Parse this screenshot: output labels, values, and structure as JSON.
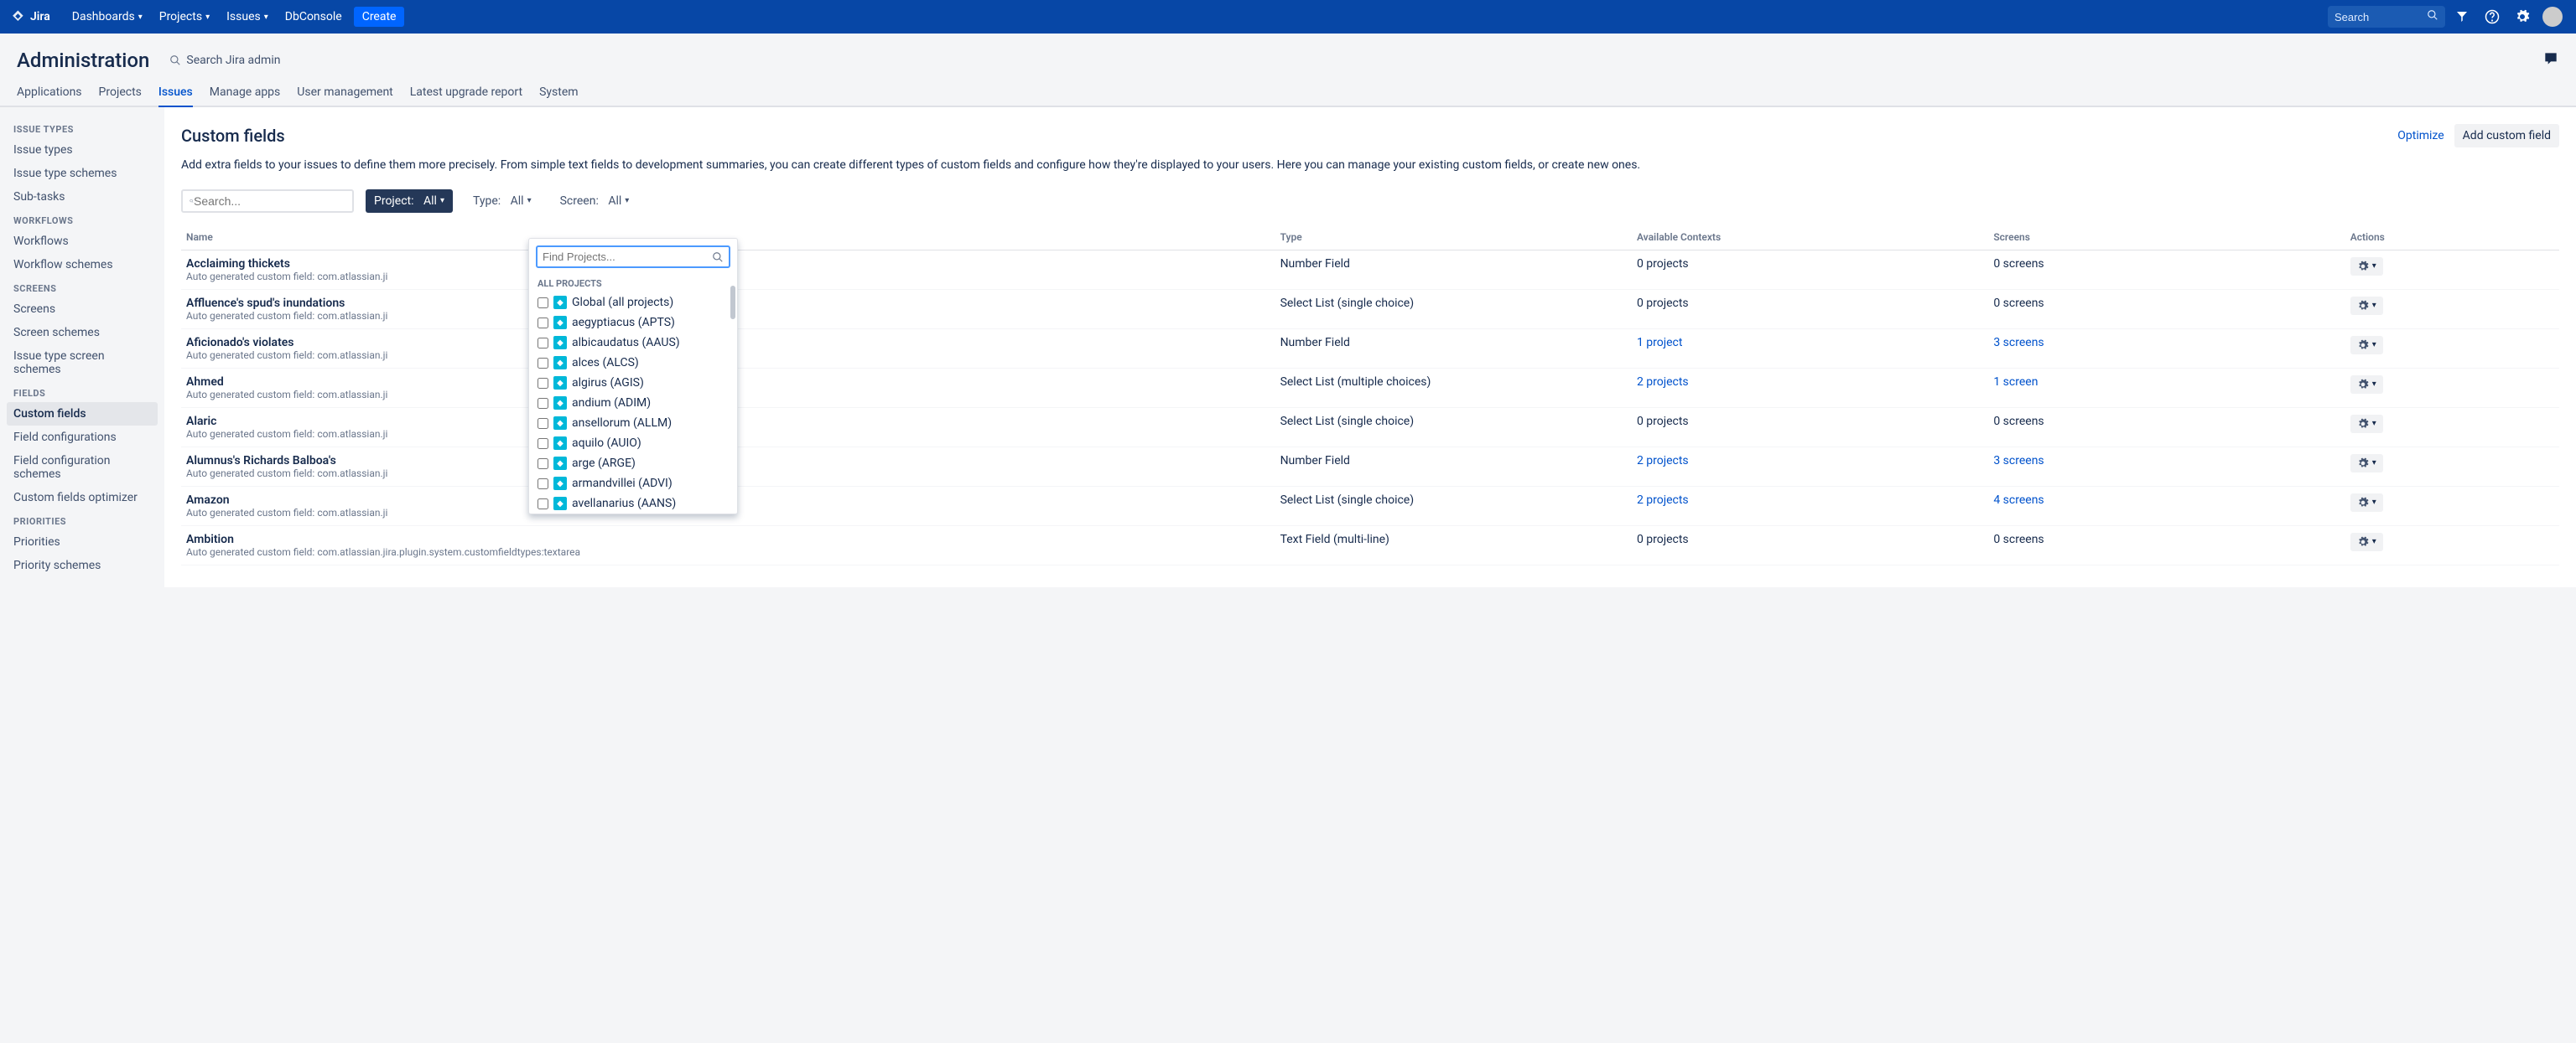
{
  "topnav": {
    "product": "Jira",
    "items": [
      "Dashboards",
      "Projects",
      "Issues",
      "DbConsole"
    ],
    "create": "Create",
    "search_placeholder": "Search"
  },
  "admin": {
    "title": "Administration",
    "search_label": "Search Jira admin",
    "tabs": [
      "Applications",
      "Projects",
      "Issues",
      "Manage apps",
      "User management",
      "Latest upgrade report",
      "System"
    ],
    "active_tab": 2
  },
  "sidebar": {
    "groups": [
      {
        "heading": "ISSUE TYPES",
        "items": [
          "Issue types",
          "Issue type schemes",
          "Sub-tasks"
        ]
      },
      {
        "heading": "WORKFLOWS",
        "items": [
          "Workflows",
          "Workflow schemes"
        ]
      },
      {
        "heading": "SCREENS",
        "items": [
          "Screens",
          "Screen schemes",
          "Issue type screen schemes"
        ]
      },
      {
        "heading": "FIELDS",
        "items": [
          "Custom fields",
          "Field configurations",
          "Field configuration schemes",
          "Custom fields optimizer"
        ]
      },
      {
        "heading": "PRIORITIES",
        "items": [
          "Priorities",
          "Priority schemes"
        ]
      }
    ],
    "active": "Custom fields"
  },
  "page": {
    "title": "Custom fields",
    "desc": "Add extra fields to your issues to define them more precisely. From simple text fields to development summaries, you can create different types of custom fields and configure how they're displayed to your users. Here you can manage your existing custom fields, or create new ones.",
    "optimize": "Optimize",
    "add": "Add custom field",
    "search_placeholder": "Search..."
  },
  "filters": {
    "project": {
      "label": "Project:",
      "value": "All"
    },
    "type": {
      "label": "Type:",
      "value": "All"
    },
    "screen": {
      "label": "Screen:",
      "value": "All"
    }
  },
  "dropdown": {
    "placeholder": "Find Projects...",
    "heading": "ALL PROJECTS",
    "items": [
      "Global (all projects)",
      "aegyptiacus (APTS)",
      "albicaudatus (AAUS)",
      "alces (ALCS)",
      "algirus (AGIS)",
      "andium (ADIM)",
      "ansellorum (ALLM)",
      "aquilo (AUIO)",
      "arge (ARGE)",
      "armandvillei (ADVI)",
      "avellanarius (AANS)"
    ]
  },
  "table": {
    "cols": [
      "Name",
      "Type",
      "Available Contexts",
      "Screens",
      "Actions"
    ],
    "rows": [
      {
        "name": "Acclaiming thickets",
        "sub": "Auto generated custom field: com.atlassian.ji",
        "type": "Number Field",
        "ctx": "0 projects",
        "ctx_link": false,
        "scr": "0 screens",
        "scr_link": false
      },
      {
        "name": "Affluence's spud's inundations",
        "sub": "Auto generated custom field: com.atlassian.ji",
        "type": "Select List (single choice)",
        "ctx": "0 projects",
        "ctx_link": false,
        "scr": "0 screens",
        "scr_link": false
      },
      {
        "name": "Aficionado's violates",
        "sub": "Auto generated custom field: com.atlassian.ji",
        "type": "Number Field",
        "ctx": "1 project",
        "ctx_link": true,
        "scr": "3 screens",
        "scr_link": true
      },
      {
        "name": "Ahmed",
        "sub": "Auto generated custom field: com.atlassian.ji",
        "type": "Select List (multiple choices)",
        "ctx": "2 projects",
        "ctx_link": true,
        "scr": "1 screen",
        "scr_link": true
      },
      {
        "name": "Alaric",
        "sub": "Auto generated custom field: com.atlassian.ji",
        "type": "Select List (single choice)",
        "ctx": "0 projects",
        "ctx_link": false,
        "scr": "0 screens",
        "scr_link": false
      },
      {
        "name": "Alumnus's Richards Balboa's",
        "sub": "Auto generated custom field: com.atlassian.ji",
        "type": "Number Field",
        "ctx": "2 projects",
        "ctx_link": true,
        "scr": "3 screens",
        "scr_link": true
      },
      {
        "name": "Amazon",
        "sub": "Auto generated custom field: com.atlassian.ji",
        "type": "Select List (single choice)",
        "ctx": "2 projects",
        "ctx_link": true,
        "scr": "4 screens",
        "scr_link": true
      },
      {
        "name": "Ambition",
        "sub": "Auto generated custom field: com.atlassian.jira.plugin.system.customfieldtypes:textarea",
        "type": "Text Field (multi-line)",
        "ctx": "0 projects",
        "ctx_link": false,
        "scr": "0 screens",
        "scr_link": false
      }
    ]
  }
}
